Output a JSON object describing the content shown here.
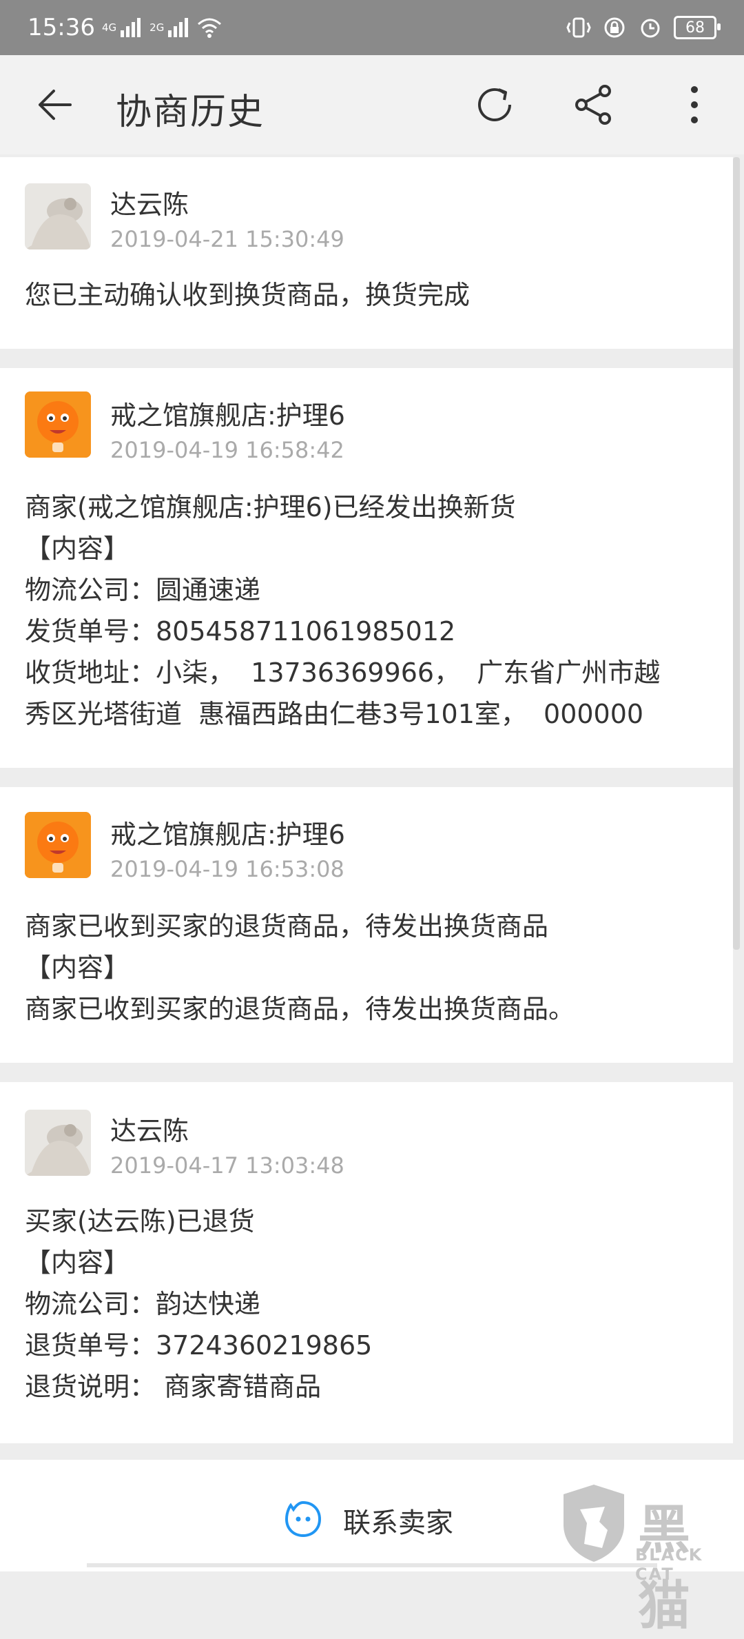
{
  "status_bar": {
    "time": "15:36",
    "net1": "4G",
    "net2": "2G",
    "battery": "68"
  },
  "app_bar": {
    "title": "协商历史"
  },
  "entries": [
    {
      "name": "达云陈",
      "time": "2019-04-21 15:30:49",
      "avatar": "buyer-avatar",
      "lines": [
        "您已主动确认收到换货商品，换货完成"
      ]
    },
    {
      "name": "戒之馆旗舰店:护理6",
      "time": "2019-04-19 16:58:42",
      "avatar": "seller-avatar",
      "lines": [
        "商家(戒之馆旗舰店:护理6)已经发出换新货",
        "【内容】",
        "物流公司：圆通速递",
        "发货单号：805458711061985012",
        "收货地址：小柒，  13736369966，  广东省广州市越",
        "秀区光塔街道  惠福西路由仁巷3号101室，  000000"
      ]
    },
    {
      "name": "戒之馆旗舰店:护理6",
      "time": "2019-04-19 16:53:08",
      "avatar": "seller-avatar",
      "lines": [
        "商家已收到买家的退货商品，待发出换货商品",
        "【内容】",
        "商家已收到买家的退货商品，待发出换货商品。"
      ]
    },
    {
      "name": "达云陈",
      "time": "2019-04-17 13:03:48",
      "avatar": "buyer-avatar",
      "lines": [
        "买家(达云陈)已退货",
        "【内容】",
        "物流公司：韵达快递",
        "退货单号：3724360219865",
        "退货说明： 商家寄错商品"
      ]
    }
  ],
  "bottom": {
    "contact_label": "联系卖家"
  },
  "watermark": {
    "cn": "黑猫",
    "en": "BLACK CAT"
  },
  "colors": {
    "accent": "#2196f3",
    "seller_avatar_bg": "#f7941d",
    "divider": "#ededed"
  }
}
